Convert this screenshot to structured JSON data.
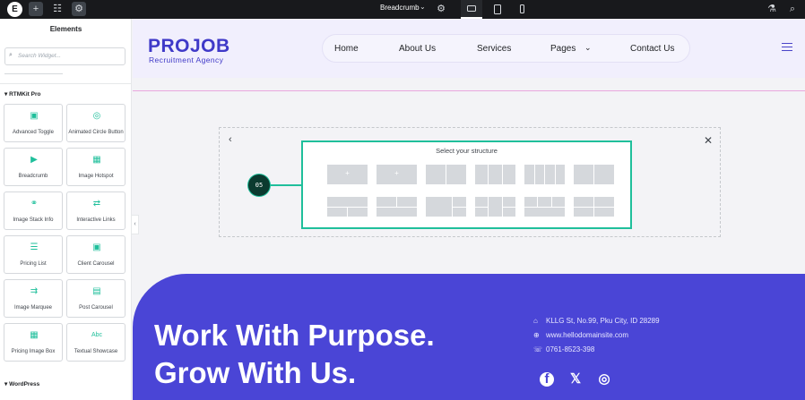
{
  "topbar": {
    "logo": "E",
    "add_glyph": "+",
    "structure_glyph": "☷",
    "site_settings_glyph": "⚙",
    "page_name": "Breadcrumb",
    "chevron_glyph": "⌄",
    "page_settings_glyph": "⚙",
    "history_glyph": "⚗",
    "search_glyph": "⌕"
  },
  "sidebar": {
    "title": "Elements",
    "search_placeholder": "Search Widget...",
    "search_glyph": "⌕",
    "category_rtmkit": "RTMKit Pro",
    "category_wordpress": "WordPress",
    "widgets": [
      {
        "label": "Advanced Toggle",
        "icon": "toggle-icon",
        "glyph": "▣"
      },
      {
        "label": "Animated Circle Button",
        "icon": "circle-button-icon",
        "glyph": "◎"
      },
      {
        "label": "Breadcrumb",
        "icon": "breadcrumb-icon",
        "glyph": "▶"
      },
      {
        "label": "Image Hotspot",
        "icon": "hotspot-icon",
        "glyph": "▦"
      },
      {
        "label": "Image Stack Info",
        "icon": "stack-icon",
        "glyph": "⚭"
      },
      {
        "label": "Interactive Links",
        "icon": "links-icon",
        "glyph": "⇄"
      },
      {
        "label": "Pricing List",
        "icon": "pricing-list-icon",
        "glyph": "☰"
      },
      {
        "label": "Client Carousel",
        "icon": "carousel-icon",
        "glyph": "▣"
      },
      {
        "label": "Image Marquee",
        "icon": "marquee-icon",
        "glyph": "⇉"
      },
      {
        "label": "Post Carousel",
        "icon": "post-carousel-icon",
        "glyph": "▤"
      },
      {
        "label": "Pricing Image Box",
        "icon": "pricing-box-icon",
        "glyph": "▦"
      },
      {
        "label": "Textual Showcase",
        "icon": "text-showcase-icon",
        "glyph": "Abc"
      }
    ]
  },
  "collapse_glyph": "‹",
  "header": {
    "logo_main": "PROJOB",
    "logo_sub": "Recruitment Agency",
    "nav": [
      "Home",
      "About Us",
      "Services",
      "Pages",
      "Contact Us"
    ],
    "pages_chevron": "⌄"
  },
  "structure": {
    "title": "Select your structure",
    "step": "05",
    "back_glyph": "‹",
    "close_glyph": "✕",
    "plus_glyph": "+",
    "accent": "#1fbf9b"
  },
  "footer": {
    "headline_1": "Work With Purpose.",
    "headline_2": "Grow With Us.",
    "address": "KLLG St, No.99, Pku City, ID 28289",
    "website": "www.hellodomainsite.com",
    "phone": "0761-8523-398",
    "address_glyph": "⌂",
    "website_glyph": "⊕",
    "phone_glyph": "☏",
    "social_facebook": "f",
    "social_x": "𝕏",
    "social_instagram": "◎",
    "background": "#4a45d6"
  }
}
